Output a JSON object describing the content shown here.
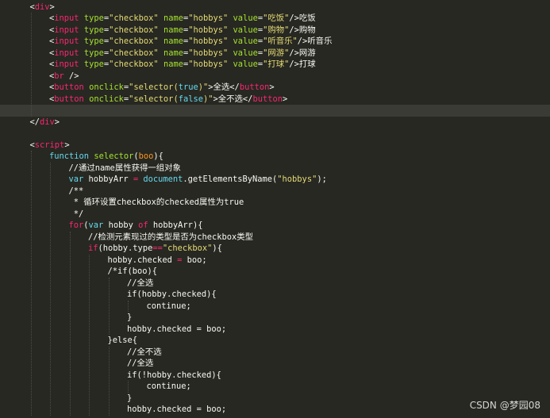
{
  "theme": {
    "background": "#272822",
    "current_line": "#3a3b35",
    "colors": {
      "tag": "#f92672",
      "attr": "#a6e22e",
      "str": "#e6db74",
      "kw": "#66d9ef",
      "fn": "#a6e22e",
      "param": "#fd971f",
      "num": "#ae81ff",
      "text": "#f8f8f2",
      "comment": "#f8f8f2"
    }
  },
  "code_lines": [
    {
      "indent": 1,
      "tokens": [
        {
          "t": "<",
          "c": "text"
        },
        {
          "t": "div",
          "c": "tag"
        },
        {
          "t": ">",
          "c": "text"
        }
      ]
    },
    {
      "indent": 2,
      "tokens": [
        {
          "t": "<",
          "c": "text"
        },
        {
          "t": "input",
          "c": "tag"
        },
        {
          "t": " ",
          "c": "text"
        },
        {
          "t": "type",
          "c": "attr"
        },
        {
          "t": "=",
          "c": "text"
        },
        {
          "t": "\"checkbox\"",
          "c": "str"
        },
        {
          "t": " ",
          "c": "text"
        },
        {
          "t": "name",
          "c": "attr"
        },
        {
          "t": "=",
          "c": "text"
        },
        {
          "t": "\"hobbys\"",
          "c": "str"
        },
        {
          "t": " ",
          "c": "text"
        },
        {
          "t": "value",
          "c": "attr"
        },
        {
          "t": "=",
          "c": "text"
        },
        {
          "t": "\"吃饭\"",
          "c": "str"
        },
        {
          "t": "/>吃饭",
          "c": "text"
        }
      ]
    },
    {
      "indent": 2,
      "tokens": [
        {
          "t": "<",
          "c": "text"
        },
        {
          "t": "input",
          "c": "tag"
        },
        {
          "t": " ",
          "c": "text"
        },
        {
          "t": "type",
          "c": "attr"
        },
        {
          "t": "=",
          "c": "text"
        },
        {
          "t": "\"checkbox\"",
          "c": "str"
        },
        {
          "t": " ",
          "c": "text"
        },
        {
          "t": "name",
          "c": "attr"
        },
        {
          "t": "=",
          "c": "text"
        },
        {
          "t": "\"hobbys\"",
          "c": "str"
        },
        {
          "t": " ",
          "c": "text"
        },
        {
          "t": "value",
          "c": "attr"
        },
        {
          "t": "=",
          "c": "text"
        },
        {
          "t": "\"购物\"",
          "c": "str"
        },
        {
          "t": "/>购物",
          "c": "text"
        }
      ]
    },
    {
      "indent": 2,
      "tokens": [
        {
          "t": "<",
          "c": "text"
        },
        {
          "t": "input",
          "c": "tag"
        },
        {
          "t": " ",
          "c": "text"
        },
        {
          "t": "type",
          "c": "attr"
        },
        {
          "t": "=",
          "c": "text"
        },
        {
          "t": "\"checkbox\"",
          "c": "str"
        },
        {
          "t": " ",
          "c": "text"
        },
        {
          "t": "name",
          "c": "attr"
        },
        {
          "t": "=",
          "c": "text"
        },
        {
          "t": "\"hobbys\"",
          "c": "str"
        },
        {
          "t": " ",
          "c": "text"
        },
        {
          "t": "value",
          "c": "attr"
        },
        {
          "t": "=",
          "c": "text"
        },
        {
          "t": "\"听音乐\"",
          "c": "str"
        },
        {
          "t": "/>听音乐",
          "c": "text"
        }
      ]
    },
    {
      "indent": 2,
      "tokens": [
        {
          "t": "<",
          "c": "text"
        },
        {
          "t": "input",
          "c": "tag"
        },
        {
          "t": " ",
          "c": "text"
        },
        {
          "t": "type",
          "c": "attr"
        },
        {
          "t": "=",
          "c": "text"
        },
        {
          "t": "\"checkbox\"",
          "c": "str"
        },
        {
          "t": " ",
          "c": "text"
        },
        {
          "t": "name",
          "c": "attr"
        },
        {
          "t": "=",
          "c": "text"
        },
        {
          "t": "\"hobbys\"",
          "c": "str"
        },
        {
          "t": " ",
          "c": "text"
        },
        {
          "t": "value",
          "c": "attr"
        },
        {
          "t": "=",
          "c": "text"
        },
        {
          "t": "\"网游\"",
          "c": "str"
        },
        {
          "t": "/>网游",
          "c": "text"
        }
      ]
    },
    {
      "indent": 2,
      "tokens": [
        {
          "t": "<",
          "c": "text"
        },
        {
          "t": "input",
          "c": "tag"
        },
        {
          "t": " ",
          "c": "text"
        },
        {
          "t": "type",
          "c": "attr"
        },
        {
          "t": "=",
          "c": "text"
        },
        {
          "t": "\"checkbox\"",
          "c": "str"
        },
        {
          "t": " ",
          "c": "text"
        },
        {
          "t": "name",
          "c": "attr"
        },
        {
          "t": "=",
          "c": "text"
        },
        {
          "t": "\"hobbys\"",
          "c": "str"
        },
        {
          "t": " ",
          "c": "text"
        },
        {
          "t": "value",
          "c": "attr"
        },
        {
          "t": "=",
          "c": "text"
        },
        {
          "t": "\"打球\"",
          "c": "str"
        },
        {
          "t": "/>打球",
          "c": "text"
        }
      ]
    },
    {
      "indent": 2,
      "tokens": [
        {
          "t": "<",
          "c": "text"
        },
        {
          "t": "br",
          "c": "tag"
        },
        {
          "t": " />",
          "c": "text"
        }
      ]
    },
    {
      "indent": 2,
      "tokens": [
        {
          "t": "<",
          "c": "text"
        },
        {
          "t": "button",
          "c": "tag"
        },
        {
          "t": " ",
          "c": "text"
        },
        {
          "t": "onclick",
          "c": "attr"
        },
        {
          "t": "=",
          "c": "text"
        },
        {
          "t": "\"selector(",
          "c": "str"
        },
        {
          "t": "true",
          "c": "kw"
        },
        {
          "t": ")\"",
          "c": "str"
        },
        {
          "t": ">全选</",
          "c": "text"
        },
        {
          "t": "button",
          "c": "tag"
        },
        {
          "t": ">",
          "c": "text"
        }
      ]
    },
    {
      "indent": 2,
      "tokens": [
        {
          "t": "<",
          "c": "text"
        },
        {
          "t": "button",
          "c": "tag"
        },
        {
          "t": " ",
          "c": "text"
        },
        {
          "t": "onclick",
          "c": "attr"
        },
        {
          "t": "=",
          "c": "text"
        },
        {
          "t": "\"selector(",
          "c": "str"
        },
        {
          "t": "false",
          "c": "kw"
        },
        {
          "t": ")\"",
          "c": "str"
        },
        {
          "t": ">全不选</",
          "c": "text"
        },
        {
          "t": "button",
          "c": "tag"
        },
        {
          "t": ">",
          "c": "text"
        }
      ]
    },
    {
      "indent": 0,
      "tokens": [],
      "current": true
    },
    {
      "indent": 1,
      "tokens": [
        {
          "t": "</",
          "c": "text"
        },
        {
          "t": "div",
          "c": "tag"
        },
        {
          "t": ">",
          "c": "text"
        }
      ]
    },
    {
      "indent": 0,
      "tokens": []
    },
    {
      "indent": 1,
      "tokens": [
        {
          "t": "<",
          "c": "text"
        },
        {
          "t": "script",
          "c": "tag"
        },
        {
          "t": ">",
          "c": "text"
        }
      ]
    },
    {
      "indent": 2,
      "tokens": [
        {
          "t": "function",
          "c": "kw"
        },
        {
          "t": " ",
          "c": "text"
        },
        {
          "t": "selector",
          "c": "fn"
        },
        {
          "t": "(",
          "c": "text"
        },
        {
          "t": "boo",
          "c": "param"
        },
        {
          "t": "){",
          "c": "text"
        }
      ]
    },
    {
      "indent": 3,
      "tokens": [
        {
          "t": "//通过name属性获得一组对象",
          "c": "comment"
        }
      ]
    },
    {
      "indent": 3,
      "tokens": [
        {
          "t": "var",
          "c": "kw"
        },
        {
          "t": " hobbyArr ",
          "c": "text"
        },
        {
          "t": "=",
          "c": "tag"
        },
        {
          "t": " ",
          "c": "text"
        },
        {
          "t": "document",
          "c": "kw"
        },
        {
          "t": ".getElementsByName(",
          "c": "text"
        },
        {
          "t": "\"hobbys\"",
          "c": "str"
        },
        {
          "t": ");",
          "c": "text"
        }
      ]
    },
    {
      "indent": 3,
      "tokens": [
        {
          "t": "/**",
          "c": "comment"
        }
      ]
    },
    {
      "indent": 3,
      "tokens": [
        {
          "t": " * 循环设置checkbox的checked属性为true",
          "c": "comment"
        }
      ]
    },
    {
      "indent": 3,
      "tokens": [
        {
          "t": " */",
          "c": "comment"
        }
      ]
    },
    {
      "indent": 3,
      "tokens": [
        {
          "t": "for",
          "c": "tag"
        },
        {
          "t": "(",
          "c": "text"
        },
        {
          "t": "var",
          "c": "kw"
        },
        {
          "t": " hobby ",
          "c": "text"
        },
        {
          "t": "of",
          "c": "tag"
        },
        {
          "t": " hobbyArr){",
          "c": "text"
        }
      ]
    },
    {
      "indent": 4,
      "tokens": [
        {
          "t": "//检测元素现过的类型是否为checkbox类型",
          "c": "comment"
        }
      ]
    },
    {
      "indent": 4,
      "tokens": [
        {
          "t": "if",
          "c": "tag"
        },
        {
          "t": "(hobby.type",
          "c": "text"
        },
        {
          "t": "==",
          "c": "tag"
        },
        {
          "t": "\"checkbox\"",
          "c": "str"
        },
        {
          "t": "){",
          "c": "text"
        }
      ]
    },
    {
      "indent": 5,
      "tokens": [
        {
          "t": "hobby.checked ",
          "c": "text"
        },
        {
          "t": "=",
          "c": "tag"
        },
        {
          "t": " boo;",
          "c": "text"
        }
      ]
    },
    {
      "indent": 5,
      "tokens": [
        {
          "t": "/*if(boo){",
          "c": "comment"
        }
      ]
    },
    {
      "indent": 6,
      "tokens": [
        {
          "t": "//全选",
          "c": "comment"
        }
      ]
    },
    {
      "indent": 6,
      "tokens": [
        {
          "t": "if(hobby.checked){",
          "c": "comment"
        }
      ]
    },
    {
      "indent": 7,
      "tokens": [
        {
          "t": "continue;",
          "c": "comment"
        }
      ]
    },
    {
      "indent": 6,
      "tokens": [
        {
          "t": "}",
          "c": "comment"
        }
      ]
    },
    {
      "indent": 6,
      "tokens": [
        {
          "t": "hobby.checked = boo;",
          "c": "comment"
        }
      ]
    },
    {
      "indent": 5,
      "tokens": [
        {
          "t": "}else{",
          "c": "comment"
        }
      ]
    },
    {
      "indent": 6,
      "tokens": [
        {
          "t": "//全不选",
          "c": "comment"
        }
      ]
    },
    {
      "indent": 6,
      "tokens": [
        {
          "t": "//全选",
          "c": "comment"
        }
      ]
    },
    {
      "indent": 6,
      "tokens": [
        {
          "t": "if(!hobby.checked){",
          "c": "comment"
        }
      ]
    },
    {
      "indent": 7,
      "tokens": [
        {
          "t": "continue;",
          "c": "comment"
        }
      ]
    },
    {
      "indent": 6,
      "tokens": [
        {
          "t": "}",
          "c": "comment"
        }
      ]
    },
    {
      "indent": 6,
      "tokens": [
        {
          "t": "hobby.checked = boo;",
          "c": "comment"
        }
      ]
    }
  ],
  "watermark": "CSDN @梦园08"
}
